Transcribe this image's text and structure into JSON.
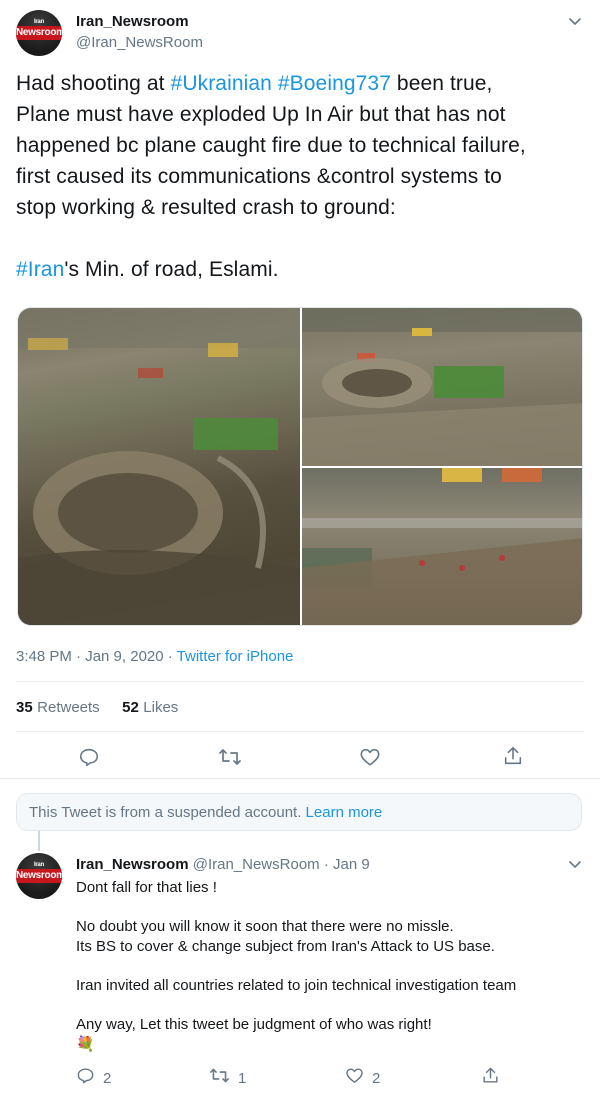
{
  "tweet": {
    "author_name": "Iran_Newsroom",
    "author_handle": "@Iran_NewsRoom",
    "avatar_label": "Newsroom",
    "avatar_small": "Iran",
    "text_lines": [
      {
        "pre": "Had shooting at ",
        "tag1": "#Ukrainian",
        "mid": " ",
        "tag2": "#Boeing737",
        "post": " been true,"
      },
      "Plane must have exploded Up In Air but that has not",
      "happened bc plane caught fire due to technical failure,",
      "first caused its communications &control systems to",
      "stop working & resulted crash to ground:"
    ],
    "line6_tag": "#Iran",
    "line6_rest": "'s Min. of road, Eslami.",
    "timestamp": "3:48 PM · Jan 9, 2020 · ",
    "source": "Twitter for iPhone",
    "retweets_count": "35",
    "retweets_label": "Retweets",
    "likes_count": "52",
    "likes_label": "Likes",
    "icons": [
      "reply-icon",
      "retweet-icon",
      "like-icon",
      "share-icon",
      "chevron-down-icon"
    ]
  },
  "notice": {
    "text": "This Tweet is from a suspended account. ",
    "link": "Learn more"
  },
  "reply": {
    "author_name": "Iran_Newsroom",
    "author_handle": "@Iran_NewsRoom",
    "sep": " · ",
    "date": "Jan 9",
    "lines": [
      "Dont fall for that lies !",
      "",
      "No doubt you will know it soon that there were no missle.",
      "Its BS to cover & change subject from Iran's Attack to US base.",
      "",
      "Iran invited all countries related to join technical investigation team",
      "",
      "Any way, Let this tweet be judgment of who was right!"
    ],
    "emoji": "💐",
    "reply_count": "2",
    "retweet_count": "1",
    "like_count": "2"
  },
  "colors": {
    "accent": "#1b95e0",
    "secondary_text": "#657786",
    "primary_text": "#14171a",
    "divider": "#e6ecf0",
    "notice_bg": "#f5f8fa",
    "logo_red": "#c8161d"
  }
}
